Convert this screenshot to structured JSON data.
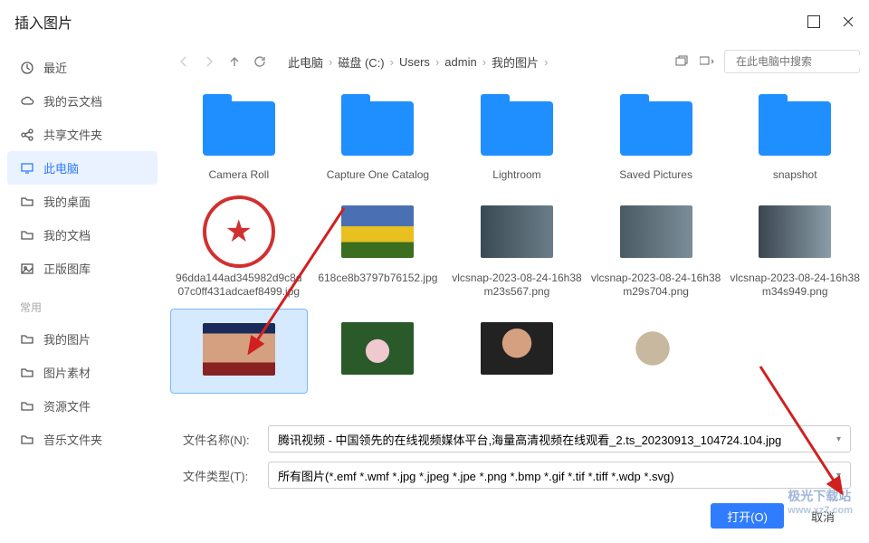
{
  "title": "插入图片",
  "sidebar": {
    "items": [
      {
        "icon": "clock",
        "label": "最近"
      },
      {
        "icon": "cloud",
        "label": "我的云文档"
      },
      {
        "icon": "share",
        "label": "共享文件夹"
      },
      {
        "icon": "monitor",
        "label": "此电脑",
        "active": true
      },
      {
        "icon": "folder",
        "label": "我的桌面"
      },
      {
        "icon": "folder",
        "label": "我的文档"
      },
      {
        "icon": "image",
        "label": "正版图库"
      }
    ],
    "section_label": "常用",
    "favorites": [
      {
        "icon": "folder",
        "label": "我的图片"
      },
      {
        "icon": "folder",
        "label": "图片素材"
      },
      {
        "icon": "folder",
        "label": "资源文件"
      },
      {
        "icon": "folder",
        "label": "音乐文件夹"
      }
    ]
  },
  "breadcrumb": [
    "此电脑",
    "磁盘 (C:)",
    "Users",
    "admin",
    "我的图片"
  ],
  "search": {
    "placeholder": "在此电脑中搜索"
  },
  "files": [
    {
      "type": "folder",
      "name": "Camera Roll"
    },
    {
      "type": "folder",
      "name": "Capture One Catalog"
    },
    {
      "type": "folder",
      "name": "Lightroom"
    },
    {
      "type": "folder",
      "name": "Saved Pictures"
    },
    {
      "type": "folder",
      "name": "snapshot"
    },
    {
      "type": "image",
      "name": "96dda144ad345982d9c8d07c0ff431adcaef8499.jpg",
      "thumb": "stamp"
    },
    {
      "type": "image",
      "name": "618ce8b3797b76152.jpg",
      "thumb": "flowers"
    },
    {
      "type": "image",
      "name": "vlcsnap-2023-08-24-16h38m23s567.png",
      "thumb": "room1"
    },
    {
      "type": "image",
      "name": "vlcsnap-2023-08-24-16h38m29s704.png",
      "thumb": "room2"
    },
    {
      "type": "image",
      "name": "vlcsnap-2023-08-24-16h38m34s949.png",
      "thumb": "room3"
    },
    {
      "type": "image",
      "name": "",
      "thumb": "people",
      "selected": true
    },
    {
      "type": "image",
      "name": "",
      "thumb": "lotus"
    },
    {
      "type": "image",
      "name": "",
      "thumb": "portrait"
    },
    {
      "type": "image",
      "name": "",
      "thumb": "drawing"
    }
  ],
  "thumb_styles": {
    "flowers": "linear-gradient(#4b6fb3 40%, #e8c020 40% 70%, #3b6e1f 70%)",
    "room1": "linear-gradient(90deg,#3a4a55,#6b7d88)",
    "room2": "linear-gradient(90deg,#4a5a65,#7b8d98)",
    "room3": "linear-gradient(90deg,#3a4550,#8b9da8)",
    "people": "linear-gradient(#1a2b5a 20%, #d4a080 20% 75%, #822 75%)",
    "lotus": "radial-gradient(circle at 50% 55%, #f0c8d0 25%, #2a5a2a 26%)",
    "portrait": "radial-gradient(circle at 50% 40%, #d4a080 30%, #222 31%)",
    "drawing": "radial-gradient(circle at 45% 50%, #c9b8a0 35%, #fff 36%)"
  },
  "filename": {
    "label": "文件名称(N):",
    "value": "腾讯视频 - 中国领先的在线视频媒体平台,海量高清视频在线观看_2.ts_20230913_104724.104.jpg"
  },
  "filetype": {
    "label": "文件类型(T):",
    "value": "所有图片(*.emf *.wmf *.jpg *.jpeg *.jpe *.png *.bmp *.gif *.tif *.tiff *.wdp *.svg)"
  },
  "buttons": {
    "open": "打开(O)",
    "cancel": "取消"
  },
  "watermark": {
    "name": "极光下载站",
    "url": "www.xz7.com"
  }
}
